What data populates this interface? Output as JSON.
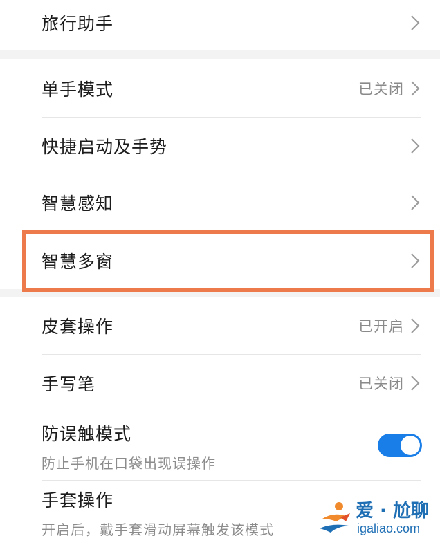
{
  "settings": {
    "travel_assistant": {
      "label": "旅行助手"
    },
    "one_hand_mode": {
      "label": "单手模式",
      "status": "已关闭"
    },
    "quick_launch": {
      "label": "快捷启动及手势"
    },
    "smart_sensing": {
      "label": "智慧感知"
    },
    "smart_multiwindow": {
      "label": "智慧多窗"
    },
    "cover_operation": {
      "label": "皮套操作",
      "status": "已开启"
    },
    "stylus": {
      "label": "手写笔",
      "status": "已关闭"
    },
    "accidental_touch": {
      "label": "防误触模式",
      "sub": "防止手机在口袋出现误操作",
      "enabled": true
    },
    "glove_mode": {
      "label": "手套操作",
      "sub": "开启后，戴手套滑动屏幕触发该模式"
    }
  },
  "watermark": {
    "title": "爱 · 尬聊",
    "url": "igaliao.com"
  },
  "colors": {
    "highlight": "#ed7a4a",
    "toggle_on": "#1a7ee8",
    "watermark": "#1f6fb5"
  },
  "icons": {
    "chevron": "chevron-right-icon",
    "watermark_logo": "site-logo-icon"
  }
}
